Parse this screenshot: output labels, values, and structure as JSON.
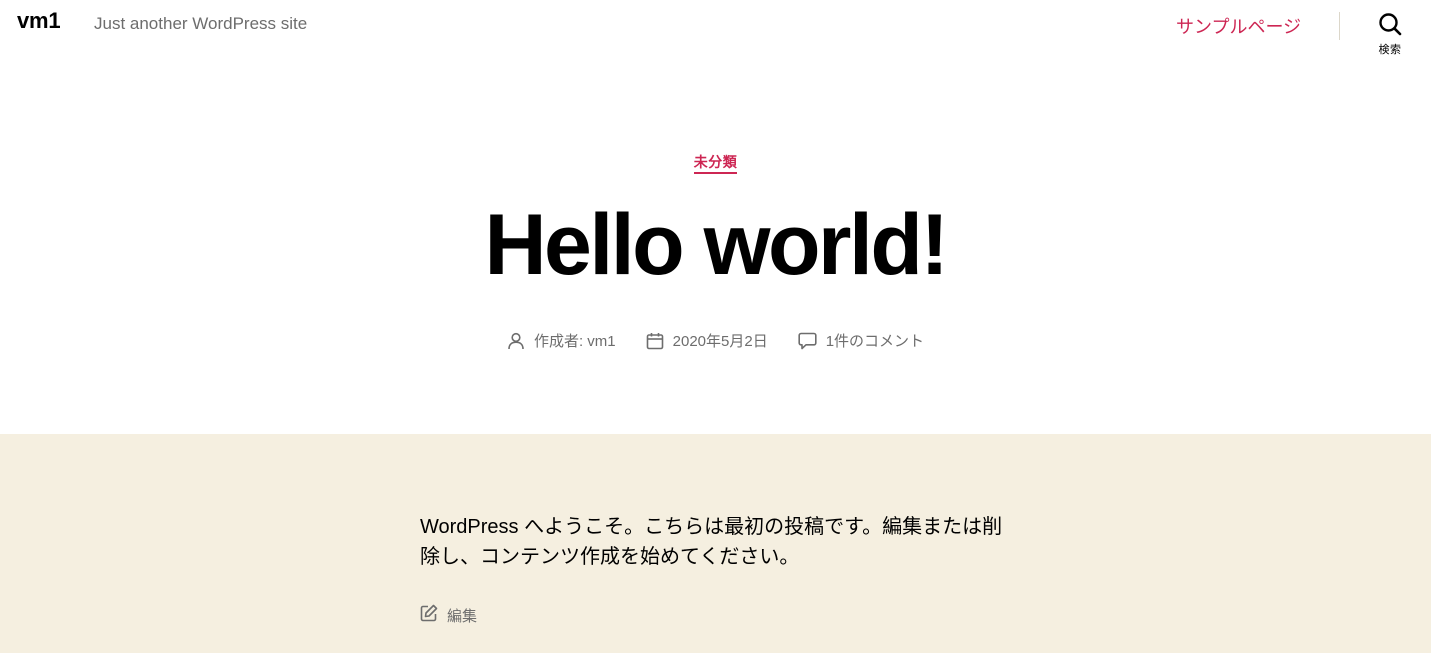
{
  "header": {
    "site_title": "vm1",
    "site_description": "Just another WordPress site",
    "nav": [
      {
        "label": "サンプルページ"
      }
    ],
    "search_label": "検索"
  },
  "post": {
    "category": "未分類",
    "title": "Hello world!",
    "meta": {
      "author": "作成者: vm1",
      "date": "2020年5月2日",
      "comments": "1件のコメント"
    },
    "content": "WordPress へようこそ。こちらは最初の投稿です。編集または削除し、コンテンツ作成を始めてください。",
    "edit_label": "編集"
  },
  "colors": {
    "accent": "#cd2653",
    "meta_text": "#6d6d6d",
    "content_bg": "#f5efe0"
  },
  "icons": {
    "search": "search-icon",
    "author": "user-icon",
    "date": "calendar-icon",
    "comments": "comment-icon",
    "edit": "edit-icon"
  }
}
